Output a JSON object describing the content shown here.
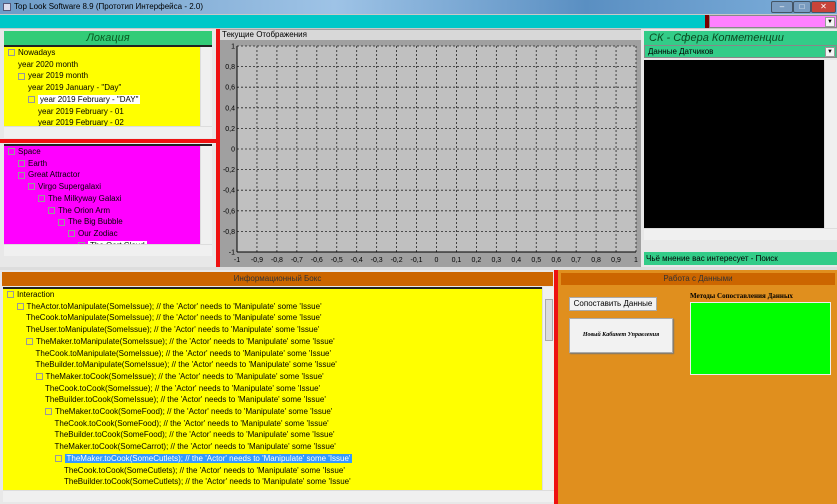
{
  "window": {
    "title": "Top Look Software 8.9 (Прототип Интерфейса - 2.0)",
    "minimize": "–",
    "maximize": "□",
    "close": "✕"
  },
  "location": {
    "header": "Локация",
    "time_tree": [
      {
        "label": "Nowadays",
        "level": 0,
        "expander": "⊟"
      },
      {
        "label": "year 2020 month",
        "level": 1
      },
      {
        "label": "year 2019 month",
        "level": 1,
        "expander": "⊟"
      },
      {
        "label": "year 2019 January - \"Day\"",
        "level": 2
      },
      {
        "label": "year 2019 February - \"DAY\"",
        "level": 2,
        "expander": "⊟",
        "selected": true
      },
      {
        "label": "year 2019 February - 01",
        "level": 3
      },
      {
        "label": "year 2019 February - 02",
        "level": 3
      }
    ],
    "space_tree": [
      {
        "label": "Space",
        "level": 0,
        "expander": "⊟"
      },
      {
        "label": "Earth",
        "level": 1,
        "expander": "⊞"
      },
      {
        "label": "Great Attractor",
        "level": 1,
        "expander": "⊟"
      },
      {
        "label": "Virgo Supergalaxi",
        "level": 2,
        "expander": "⊟"
      },
      {
        "label": "The Milkyway Galaxi",
        "level": 3,
        "expander": "⊟"
      },
      {
        "label": "The Orion Arm",
        "level": 4,
        "expander": "⊟"
      },
      {
        "label": "The Big Bubble",
        "level": 5,
        "expander": "⊟"
      },
      {
        "label": "Our Zodiac",
        "level": 6,
        "expander": "⊟"
      },
      {
        "label": "The Oort Cloud",
        "level": 7,
        "expander": "⊞",
        "selected": true
      }
    ]
  },
  "chart": {
    "title": "Текущие Отображения",
    "chart_data": {
      "type": "line",
      "series": [],
      "xlim": [
        -1,
        1
      ],
      "ylim": [
        -1,
        1
      ],
      "grid": true,
      "x_ticks": [
        "-1",
        "-0,9",
        "-0,8",
        "-0,7",
        "-0,6",
        "-0,5",
        "-0,4",
        "-0,3",
        "-0,2",
        "-0,1",
        "0",
        "0,1",
        "0,2",
        "0,3",
        "0,4",
        "0,5",
        "0,6",
        "0,7",
        "0,8",
        "0,9",
        "1"
      ],
      "y_ticks": [
        "1",
        "0,8",
        "0,6",
        "0,4",
        "0,2",
        "0",
        "-0,2",
        "-0,4",
        "-0,6",
        "-0,8",
        "-1"
      ]
    }
  },
  "competence": {
    "header": "СК - Сфера Копметенции",
    "combo_value": "Данные Датчиков",
    "status": "Чьё мнение вас интересует - Поиск"
  },
  "info": {
    "header": "Информационный Бокс",
    "tree": [
      {
        "label": "Interaction",
        "level": 0,
        "expander": "⊟"
      },
      {
        "label": "TheActor.toManipulate(SomeIssue); // the 'Actor' needs to 'Manipulate' some 'Issue'",
        "level": 1,
        "expander": "⊟"
      },
      {
        "label": "TheCook.toManipulate(SomeIssue); // the 'Actor' needs to 'Manipulate' some 'Issue'",
        "level": 2
      },
      {
        "label": "TheUser.toManipulate(SomeIssue); // the 'Actor' needs to 'Manipulate' some 'Issue'",
        "level": 2
      },
      {
        "label": "TheMaker.toManipulate(SomeIssue); // the 'Actor' needs to 'Manipulate' some 'Issue'",
        "level": 2,
        "expander": "⊟"
      },
      {
        "label": "TheCook.toManipulate(SomeIssue); // the 'Actor' needs to 'Manipulate' some 'Issue'",
        "level": 3
      },
      {
        "label": "TheBuilder.toManipulate(SomeIssue); // the 'Actor' needs to 'Manipulate' some 'Issue'",
        "level": 3
      },
      {
        "label": "TheMaker.toCook(SomeIssue); // the 'Actor' needs to 'Manipulate' some 'Issue'",
        "level": 3,
        "expander": "⊟"
      },
      {
        "label": "TheCook.toCook(SomeIssue); // the 'Actor' needs to 'Manipulate' some 'Issue'",
        "level": 4
      },
      {
        "label": "TheBuilder.toCook(SomeIssue); // the 'Actor' needs to 'Manipulate' some 'Issue'",
        "level": 4
      },
      {
        "label": "TheMaker.toCook(SomeFood); // the 'Actor' needs to 'Manipulate' some 'Issue'",
        "level": 4,
        "expander": "⊟"
      },
      {
        "label": "TheCook.toCook(SomeFood); // the 'Actor' needs to 'Manipulate' some 'Issue'",
        "level": 5
      },
      {
        "label": "TheBuilder.toCook(SomeFood); // the 'Actor' needs to 'Manipulate' some 'Issue'",
        "level": 5
      },
      {
        "label": "TheMaker.toCook(SomeCarrot); // the 'Actor' needs to 'Manipulate' some 'Issue'",
        "level": 5
      },
      {
        "label": "TheMaker.toCook(SomeCutlets); // the 'Actor' needs to 'Manipulate' some 'Issue'",
        "level": 5,
        "expander": "⊟",
        "selected": true
      },
      {
        "label": "TheCook.toCook(SomeCutlets); // the 'Actor' needs to 'Manipulate' some 'Issue'",
        "level": 6
      },
      {
        "label": "TheBuilder.toCook(SomeCutlets); // the 'Actor' needs to 'Manipulate' some 'Issue'",
        "level": 6
      }
    ]
  },
  "data_work": {
    "header": "Работа с Данными",
    "compare_button": "Сопоставить Данные",
    "cabinet_button": "Новый Кабинет Управления",
    "methods_label": "Методы Сопоставления Данных"
  },
  "colors": {
    "cyan": "#00c8c8",
    "pink": "#ff00ff",
    "yellow": "#ffff00",
    "green": "#33cc88",
    "orange": "#e09020",
    "lime": "#00ff00",
    "red": "#ee1111"
  }
}
